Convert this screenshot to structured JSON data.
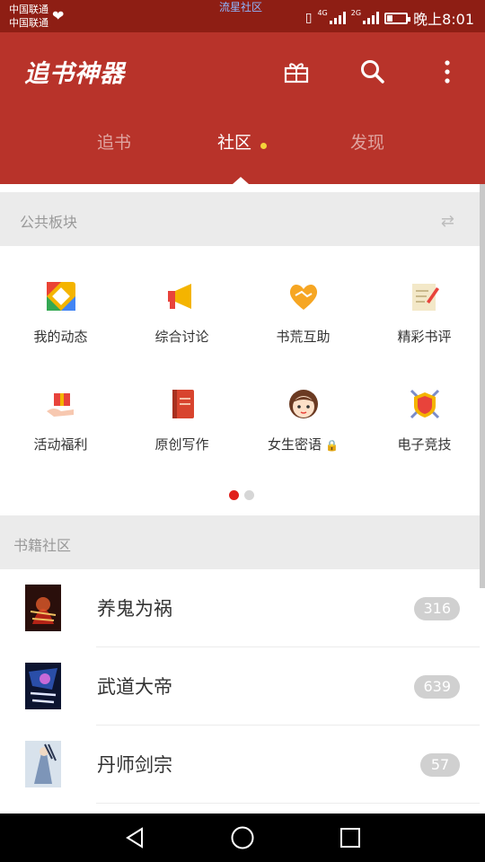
{
  "status_bar": {
    "carrier_1": "中国联通",
    "carrier_2": "中国联通",
    "top_link": "流星社区",
    "network": "4G",
    "network_2": "2G",
    "time": "晚上8:01"
  },
  "header": {
    "logo": "追书神器",
    "icons": [
      "gift-icon",
      "search-icon",
      "more-vertical-icon"
    ]
  },
  "tabs": [
    {
      "label": "追书",
      "active": false
    },
    {
      "label": "社区",
      "active": true,
      "has_dot": true
    },
    {
      "label": "发现",
      "active": false
    }
  ],
  "public_section": {
    "title": "公共板块",
    "icon": "swap-icon"
  },
  "boards": [
    {
      "label": "我的动态",
      "icon": "colorful-diamond-icon"
    },
    {
      "label": "综合讨论",
      "icon": "megaphone-icon"
    },
    {
      "label": "书荒互助",
      "icon": "handshake-heart-icon"
    },
    {
      "label": "精彩书评",
      "icon": "notepad-pencil-icon"
    },
    {
      "label": "活动福利",
      "icon": "gift-hand-icon"
    },
    {
      "label": "原创写作",
      "icon": "red-book-icon"
    },
    {
      "label": "女生密语",
      "icon": "girl-face-icon",
      "locked": true
    },
    {
      "label": "电子竞技",
      "icon": "shield-swords-icon"
    }
  ],
  "pager": {
    "pages": 2,
    "current": 1
  },
  "books_section": {
    "title": "书籍社区"
  },
  "books": [
    {
      "title": "养鬼为祸",
      "count": "316"
    },
    {
      "title": "武道大帝",
      "count": "639"
    },
    {
      "title": "丹师剑宗",
      "count": "57"
    }
  ],
  "nav": [
    "back-icon",
    "home-icon",
    "recents-icon"
  ],
  "colors": {
    "brand": "#b8332a",
    "status_bar": "#8e1e14",
    "dot_active": "#e0201c",
    "tab_dot": "#f5d33a"
  }
}
